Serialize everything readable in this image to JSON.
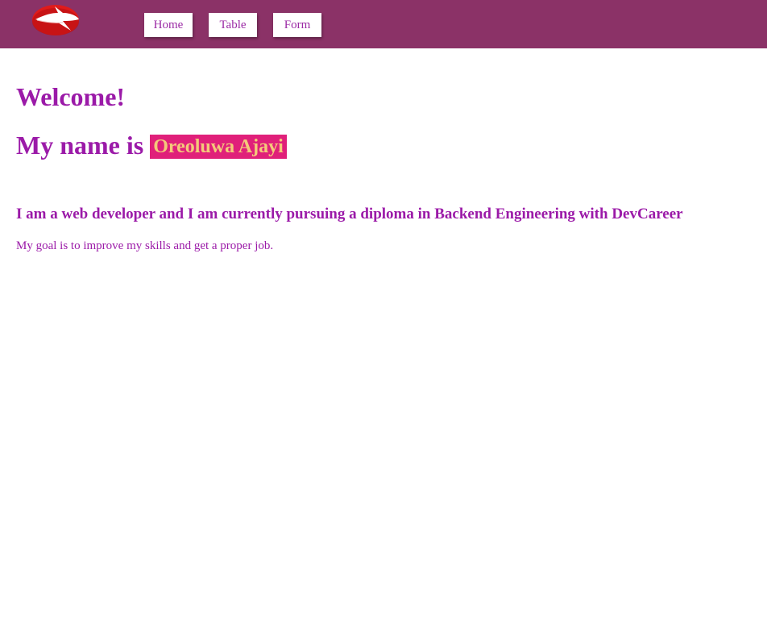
{
  "header": {
    "logo_icon": "red-bird-logo-icon",
    "nav": [
      {
        "label": "Home"
      },
      {
        "label": "Table"
      },
      {
        "label": "Form"
      }
    ]
  },
  "main": {
    "welcome": "Welcome!",
    "name_prefix": "My name is",
    "name": "Oreoluwa Ajayi",
    "intro": "I am a web developer and I am currently pursuing a diploma in Backend Engineering with DevCareer",
    "goal": "My goal is to improve my skills and get a proper job."
  },
  "colors": {
    "header_bg": "#8b3267",
    "text": "#9b1aa8",
    "name_bg": "#e0207a",
    "name_text": "#f4c97a"
  }
}
